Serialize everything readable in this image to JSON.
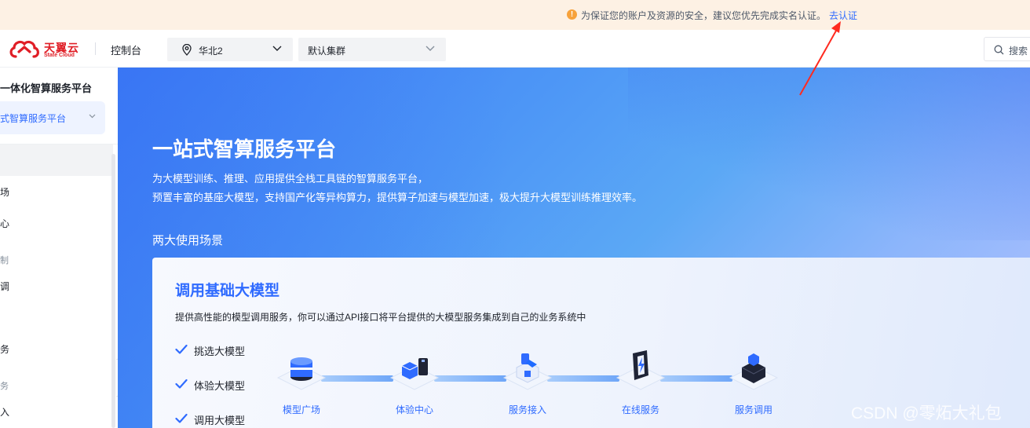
{
  "notice": {
    "icon": "warning-circle-icon",
    "text": "为保证您的账户及资源的安全，建议您优先完成实名认证。",
    "link": "去认证"
  },
  "header": {
    "logo_cn": "天翼云",
    "logo_en": "State Cloud",
    "console": "控制台",
    "region": "华北2",
    "cluster": "默认集群",
    "search_text": "搜索"
  },
  "sidebar": {
    "title": "一体化智算服务平台",
    "selected": "式智算服务平台",
    "items": [
      {
        "label": "场",
        "type": "item"
      },
      {
        "label": "心",
        "type": "item"
      },
      {
        "label": "制",
        "type": "group"
      },
      {
        "label": "调",
        "type": "item"
      },
      {
        "label": "",
        "type": "item"
      },
      {
        "label": "务",
        "type": "item"
      },
      {
        "label": "务",
        "type": "group"
      },
      {
        "label": "入",
        "type": "item"
      }
    ]
  },
  "hero": {
    "title": "一站式智算服务平台",
    "desc_line1": "为大模型训练、推理、应用提供全栈工具链的智算服务平台，",
    "desc_line2": "预置丰富的基座大模型，支持国产化等异构算力，提供算子加速与模型加速，极大提升大模型训练推理效率。",
    "scenes_label": "两大使用场景"
  },
  "card": {
    "title": "调用基础大模型",
    "desc": "提供高性能的模型调用服务，你可以通过API接口将平台提供的大模型服务集成到自己的业务系统中",
    "checks": [
      "挑选大模型",
      "体验大模型",
      "调用大模型"
    ],
    "steps": [
      "模型广场",
      "体验中心",
      "服务接入",
      "在线服务",
      "服务调用"
    ]
  },
  "colors": {
    "accent": "#2f6bff",
    "brand_red": "#e01e26",
    "notice_bg": "#fdf1e4",
    "annotation_arrow": "#ff2a1f"
  },
  "watermark": "CSDN @零炻大礼包"
}
